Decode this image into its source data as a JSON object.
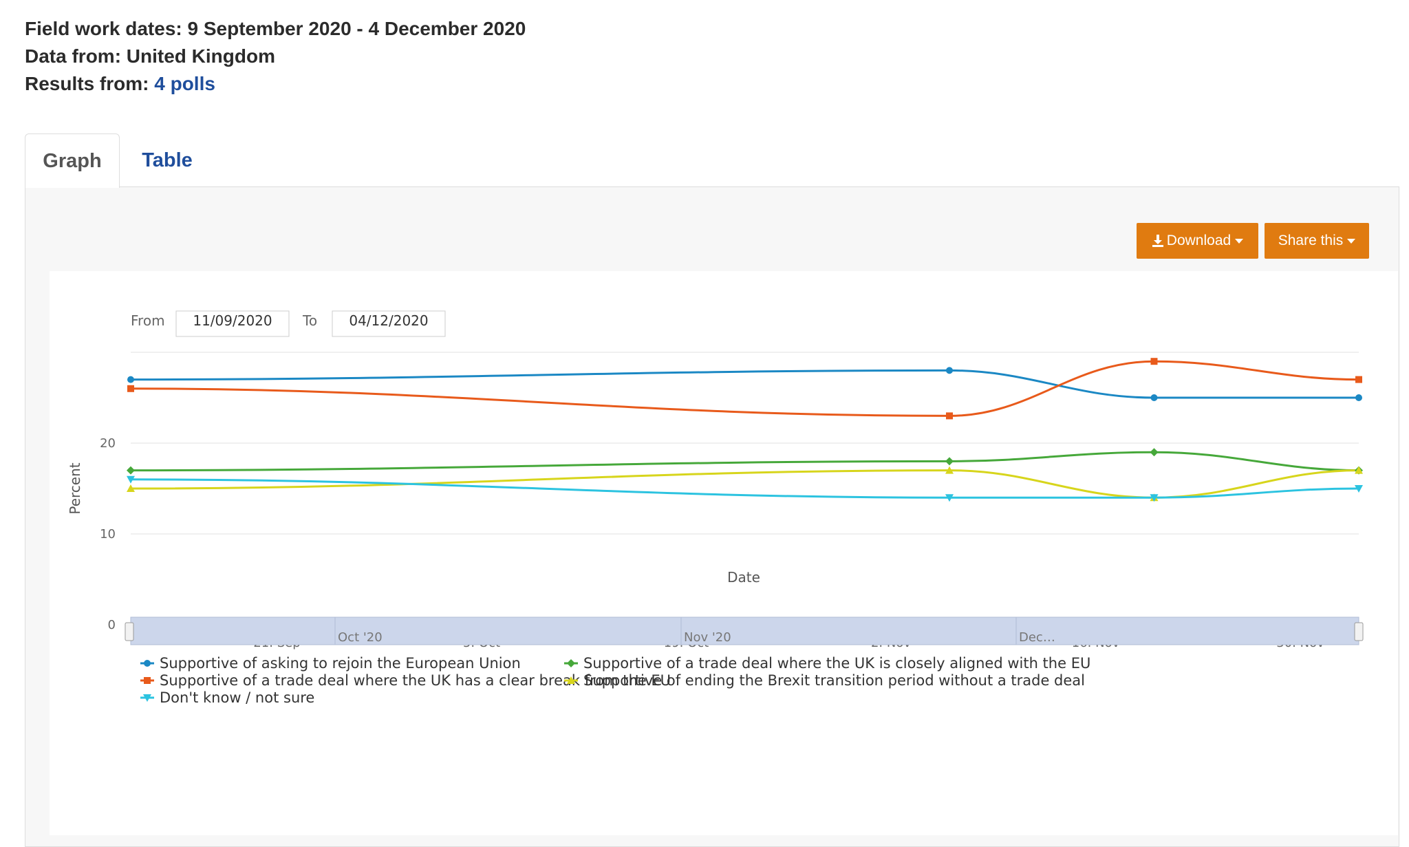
{
  "info": {
    "fieldwork_label": "Field work dates:",
    "fieldwork_value": "9 September 2020 - 4 December 2020",
    "datafrom_label": "Data from:",
    "datafrom_value": "United Kingdom",
    "results_label": "Results from:",
    "results_value": "4 polls"
  },
  "tabs": {
    "graph": "Graph",
    "table": "Table"
  },
  "buttons": {
    "download": "Download",
    "share": "Share this"
  },
  "range_selector": {
    "from_label": "From",
    "from_value": "11/09/2020",
    "to_label": "To",
    "to_value": "04/12/2020"
  },
  "colors": {
    "accent": "#e07b10",
    "link": "#1f4e9c",
    "navigator": "#ccd6eb"
  },
  "chart_data": {
    "type": "line",
    "xlabel": "Date",
    "ylabel": "Percent",
    "ylim": [
      0,
      30
    ],
    "xlim": [
      "2020-09-11",
      "2020-12-04"
    ],
    "y_ticks": [
      0,
      10,
      20
    ],
    "x_ticks": [
      {
        "date": "2020-09-21",
        "label": "21. Sep"
      },
      {
        "date": "2020-10-05",
        "label": "5. Oct"
      },
      {
        "date": "2020-10-19",
        "label": "19. Oct"
      },
      {
        "date": "2020-11-02",
        "label": "2. Nov"
      },
      {
        "date": "2020-11-16",
        "label": "16. Nov"
      },
      {
        "date": "2020-11-30",
        "label": "30. Nov"
      }
    ],
    "grid": true,
    "legend_position": "bottom",
    "x": [
      "2020-09-11",
      "2020-11-06",
      "2020-11-20",
      "2020-12-04"
    ],
    "series": [
      {
        "name": "Supportive of asking to rejoin the European Union",
        "color": "#1b88c4",
        "marker": "circle",
        "values": [
          27,
          28,
          25,
          25
        ]
      },
      {
        "name": "Supportive of a trade deal where the UK is closely aligned with the EU",
        "color": "#46a83a",
        "marker": "diamond",
        "values": [
          17,
          18,
          19,
          17
        ]
      },
      {
        "name": "Supportive of a trade deal where the UK has a clear break from the EU",
        "color": "#e85a1b",
        "marker": "square",
        "values": [
          26,
          23,
          29,
          27
        ]
      },
      {
        "name": "Supportive of ending the Brexit transition period without a trade deal",
        "color": "#d7d51c",
        "marker": "triangle",
        "values": [
          15,
          17,
          14,
          17
        ]
      },
      {
        "name": "Don't know / not sure",
        "color": "#2cc3e0",
        "marker": "triangle-down",
        "values": [
          16,
          14,
          14,
          15
        ]
      }
    ],
    "navigator": {
      "labels": [
        "Oct '20",
        "Nov '20",
        "Dec…"
      ]
    }
  }
}
